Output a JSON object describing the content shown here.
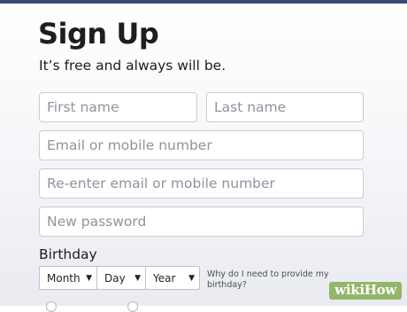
{
  "header": {
    "title": "Sign Up",
    "subtitle": "It’s free and always will be."
  },
  "form": {
    "first_name_placeholder": "First name",
    "last_name_placeholder": "Last name",
    "email_placeholder": "Email or mobile number",
    "reenter_email_placeholder": "Re-enter email or mobile number",
    "password_placeholder": "New password"
  },
  "birthday": {
    "label": "Birthday",
    "month": "Month",
    "day": "Day",
    "year": "Year",
    "why_link": "Why do I need to provide my birthday?"
  },
  "icons": {
    "dropdown": "chevron-down-icon"
  },
  "colors": {
    "top_bar": "#3a4a73",
    "field_border": "#c9ccd1",
    "placeholder": "#8d949e",
    "watermark_bg": "#93b66a"
  },
  "watermark": {
    "part1": "wiki",
    "part2": "How"
  }
}
